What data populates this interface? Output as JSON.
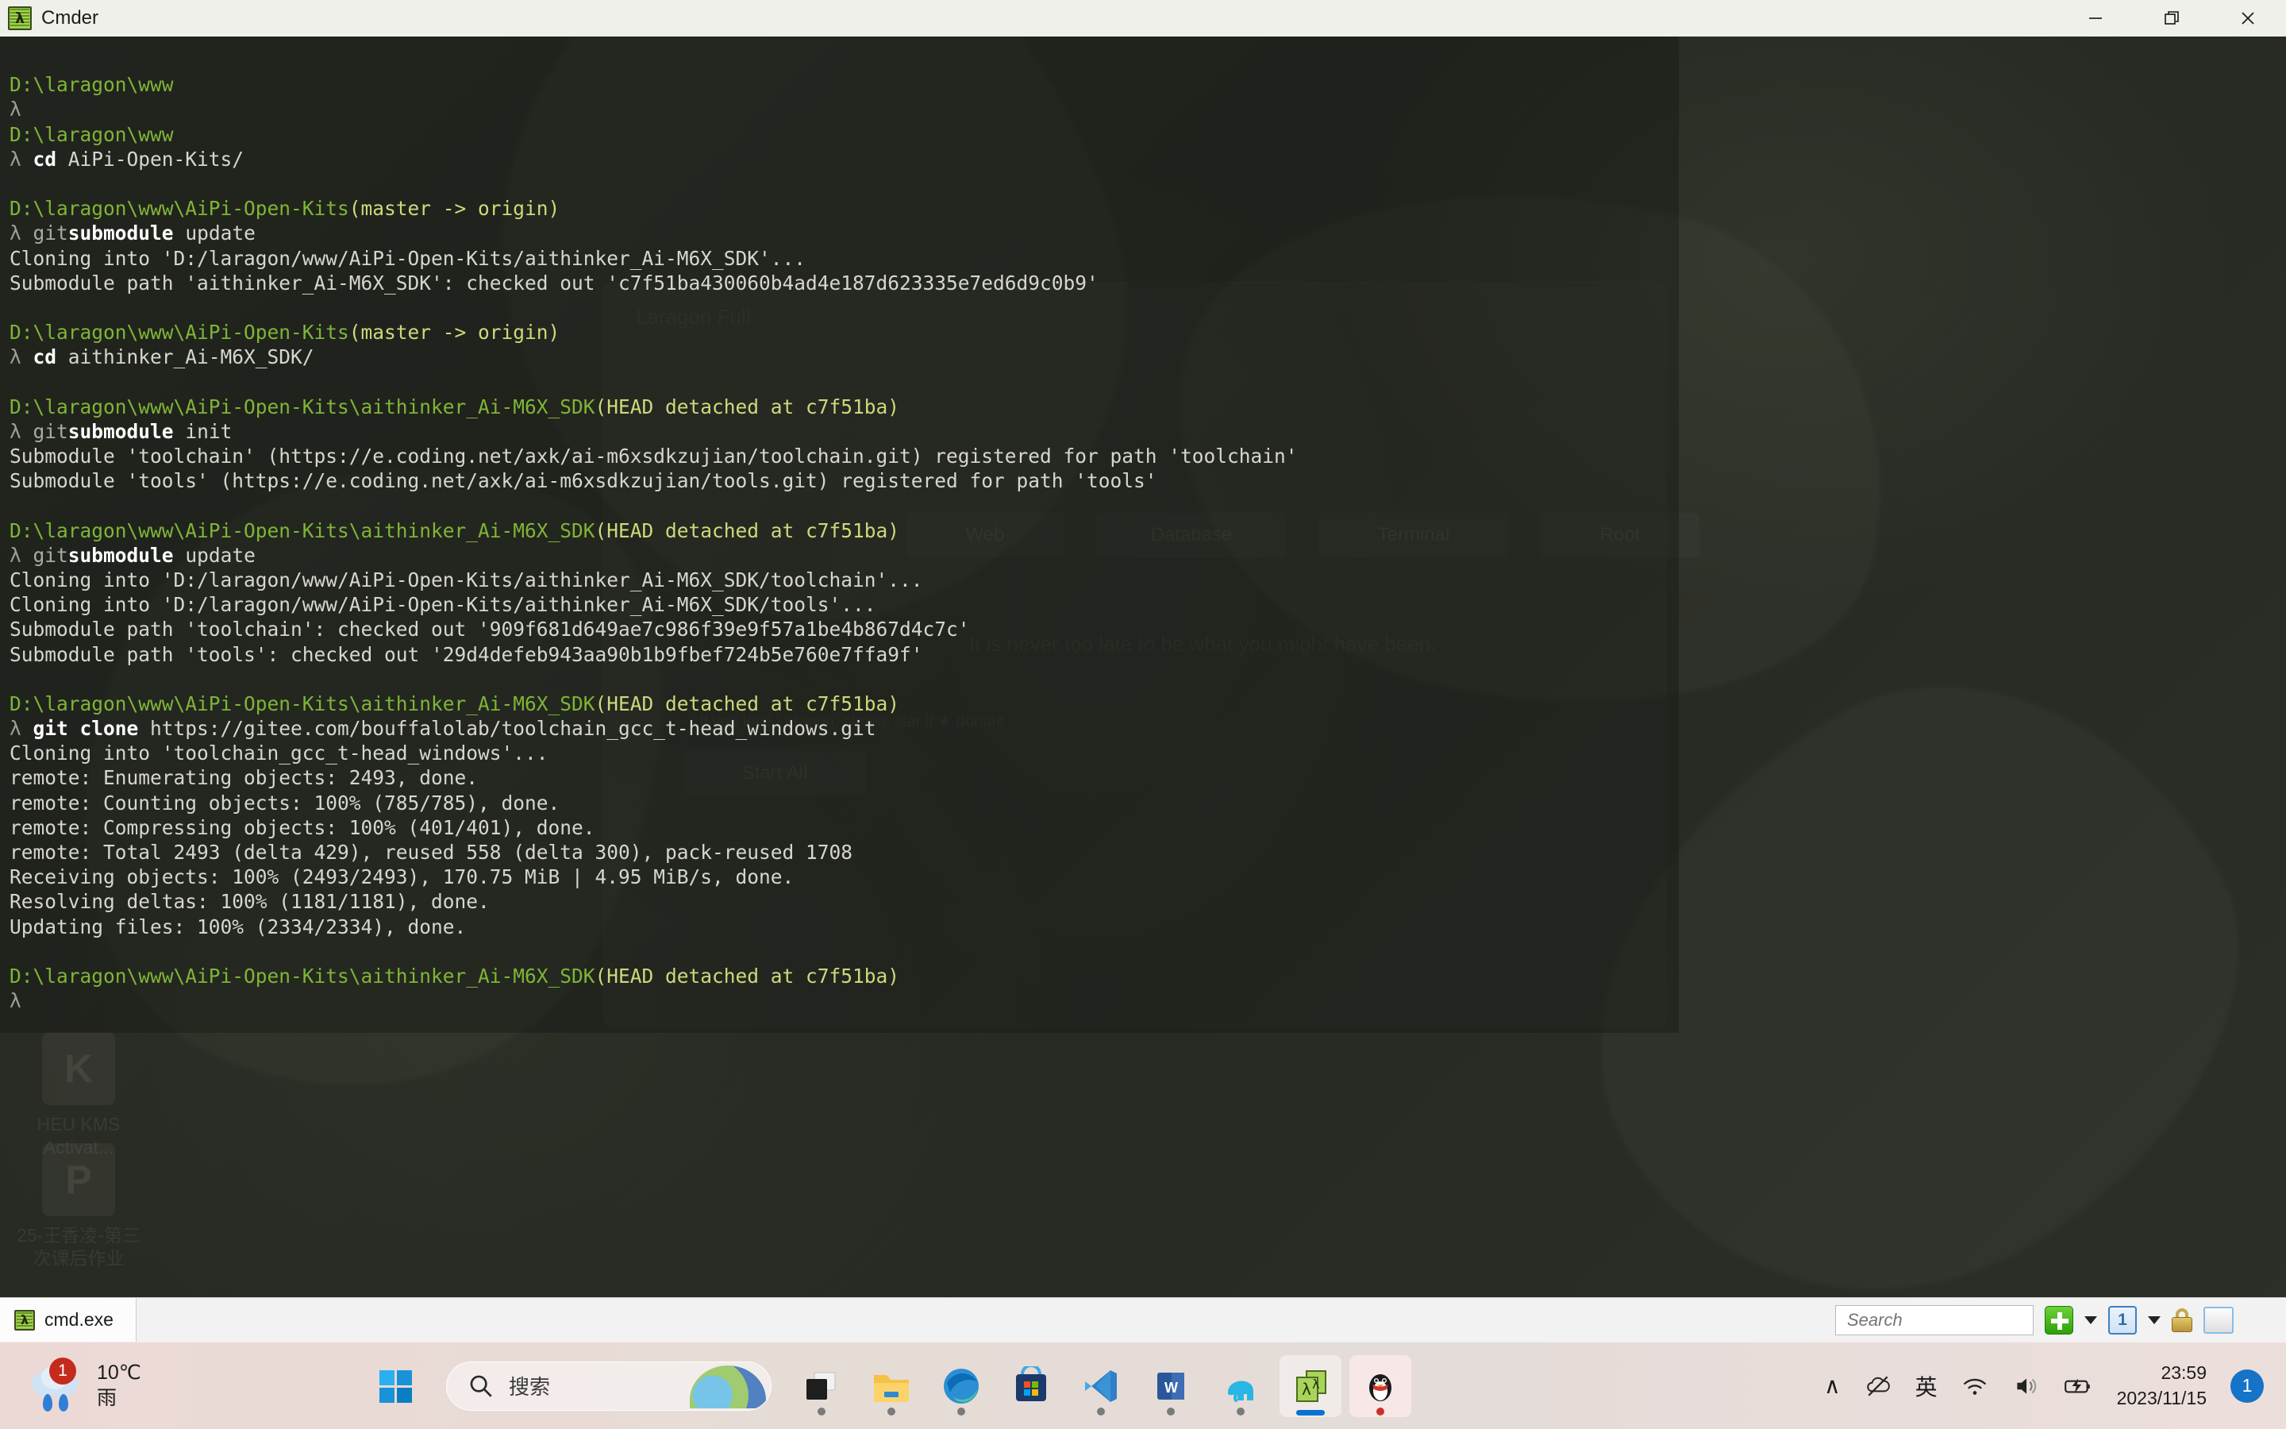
{
  "window": {
    "title": "Cmder",
    "icon": "cmder-lambda-icon",
    "controls": {
      "minimize": "—",
      "restore": "❐",
      "close": "✕"
    }
  },
  "terminal": {
    "lines": [
      {
        "type": "blank",
        "text": ""
      },
      {
        "type": "path",
        "text": "D:\\laragon\\www"
      },
      {
        "type": "prompt",
        "lambda": "λ",
        "cmd": "",
        "arg": ""
      },
      {
        "type": "path",
        "text": "D:\\laragon\\www"
      },
      {
        "type": "prompt",
        "lambda": "λ",
        "cmd": "cd",
        "arg": " AiPi-Open-Kits/"
      },
      {
        "type": "blank",
        "text": ""
      },
      {
        "type": "path-branch",
        "path": "D:\\laragon\\www\\AiPi-Open-Kits",
        "branch": "(master -> origin)"
      },
      {
        "type": "prompt-split",
        "lambda": "λ",
        "dim": "git",
        "cmd": "submodule",
        "arg": " update"
      },
      {
        "type": "out",
        "text": "Cloning into 'D:/laragon/www/AiPi-Open-Kits/aithinker_Ai-M6X_SDK'..."
      },
      {
        "type": "out",
        "text": "Submodule path 'aithinker_Ai-M6X_SDK': checked out 'c7f51ba430060b4ad4e187d623335e7ed6d9c0b9'"
      },
      {
        "type": "blank",
        "text": ""
      },
      {
        "type": "path-branch",
        "path": "D:\\laragon\\www\\AiPi-Open-Kits",
        "branch": "(master -> origin)"
      },
      {
        "type": "prompt",
        "lambda": "λ",
        "cmd": "cd",
        "arg": " aithinker_Ai-M6X_SDK/"
      },
      {
        "type": "blank",
        "text": ""
      },
      {
        "type": "path-branch",
        "path": "D:\\laragon\\www\\AiPi-Open-Kits\\aithinker_Ai-M6X_SDK",
        "branch": "(HEAD detached at c7f51ba)"
      },
      {
        "type": "prompt-split",
        "lambda": "λ",
        "dim": "git",
        "cmd": "submodule",
        "arg": " init"
      },
      {
        "type": "out",
        "text": "Submodule 'toolchain' (https://e.coding.net/axk/ai-m6xsdkzujian/toolchain.git) registered for path 'toolchain'"
      },
      {
        "type": "out",
        "text": "Submodule 'tools' (https://e.coding.net/axk/ai-m6xsdkzujian/tools.git) registered for path 'tools'"
      },
      {
        "type": "blank",
        "text": ""
      },
      {
        "type": "path-branch",
        "path": "D:\\laragon\\www\\AiPi-Open-Kits\\aithinker_Ai-M6X_SDK",
        "branch": "(HEAD detached at c7f51ba)"
      },
      {
        "type": "prompt-split",
        "lambda": "λ",
        "dim": "git",
        "cmd": "submodule",
        "arg": " update"
      },
      {
        "type": "out",
        "text": "Cloning into 'D:/laragon/www/AiPi-Open-Kits/aithinker_Ai-M6X_SDK/toolchain'..."
      },
      {
        "type": "out",
        "text": "Cloning into 'D:/laragon/www/AiPi-Open-Kits/aithinker_Ai-M6X_SDK/tools'..."
      },
      {
        "type": "out",
        "text": "Submodule path 'toolchain': checked out '909f681d649ae7c986f39e9f57a1be4b867d4c7c'"
      },
      {
        "type": "out",
        "text": "Submodule path 'tools': checked out '29d4defeb943aa90b1b9fbef724b5e760e7ffa9f'"
      },
      {
        "type": "blank",
        "text": ""
      },
      {
        "type": "path-branch",
        "path": "D:\\laragon\\www\\AiPi-Open-Kits\\aithinker_Ai-M6X_SDK",
        "branch": "(HEAD detached at c7f51ba)"
      },
      {
        "type": "prompt",
        "lambda": "λ",
        "cmd": "git clone",
        "arg": " https://gitee.com/bouffalolab/toolchain_gcc_t-head_windows.git"
      },
      {
        "type": "out",
        "text": "Cloning into 'toolchain_gcc_t-head_windows'..."
      },
      {
        "type": "out",
        "text": "remote: Enumerating objects: 2493, done."
      },
      {
        "type": "out",
        "text": "remote: Counting objects: 100% (785/785), done."
      },
      {
        "type": "out",
        "text": "remote: Compressing objects: 100% (401/401), done."
      },
      {
        "type": "out",
        "text": "remote: Total 2493 (delta 429), reused 558 (delta 300), pack-reused 1708"
      },
      {
        "type": "out",
        "text": "Receiving objects: 100% (2493/2493), 170.75 MiB | 4.95 MiB/s, done."
      },
      {
        "type": "out",
        "text": "Resolving deltas: 100% (1181/1181), done."
      },
      {
        "type": "out",
        "text": "Updating files: 100% (2334/2334), done."
      },
      {
        "type": "blank",
        "text": ""
      },
      {
        "type": "path-branch",
        "path": "D:\\laragon\\www\\AiPi-Open-Kits\\aithinker_Ai-M6X_SDK",
        "branch": "(HEAD detached at c7f51ba)"
      },
      {
        "type": "prompt",
        "lambda": "λ",
        "cmd": "",
        "arg": ""
      }
    ],
    "colors": {
      "path": "#7fb536",
      "branch": "#cdd97a",
      "output": "#d6d6d0",
      "command": "#ffffff",
      "background": "#2a2d26"
    }
  },
  "statusbar": {
    "tabs": [
      {
        "label": "cmd.exe",
        "icon": "cmder-lambda-icon"
      }
    ],
    "search": {
      "placeholder": "Search",
      "value": "",
      "icon": "search-icon"
    },
    "buttons": [
      {
        "name": "new-console-button",
        "icon": "green-plus-icon"
      },
      {
        "name": "new-console-dropdown",
        "icon": "caret-down-icon"
      },
      {
        "name": "active-console-count",
        "icon": "numbered-tab-icon",
        "label": "1"
      },
      {
        "name": "console-list-dropdown",
        "icon": "caret-down-icon"
      },
      {
        "name": "lock-button",
        "icon": "lock-icon"
      },
      {
        "name": "split-pane-button",
        "icon": "split-pane-icon"
      },
      {
        "name": "menu-button",
        "icon": "hamburger-menu-icon"
      }
    ]
  },
  "taskbar": {
    "weather": {
      "temperature": "10℃",
      "condition": "雨",
      "badge": "1",
      "icon": "rain-cloud-icon"
    },
    "start": {
      "name": "start-button",
      "icon": "windows-logo-icon"
    },
    "search": {
      "placeholder": "搜索",
      "icon": "search-icon"
    },
    "apps": [
      {
        "name": "task-view",
        "icon": "task-view-icon",
        "running": true,
        "active": false
      },
      {
        "name": "file-explorer",
        "icon": "folder-icon",
        "running": true,
        "active": false
      },
      {
        "name": "microsoft-edge",
        "icon": "edge-icon",
        "running": true,
        "active": false
      },
      {
        "name": "microsoft-store",
        "icon": "store-icon",
        "running": false,
        "active": false
      },
      {
        "name": "vs-code",
        "icon": "vscode-icon",
        "running": true,
        "active": false
      },
      {
        "name": "microsoft-word",
        "icon": "word-icon",
        "running": true,
        "active": false
      },
      {
        "name": "laragon",
        "icon": "elephant-icon",
        "running": true,
        "active": false
      },
      {
        "name": "cmder",
        "icon": "cmder-lambda-icon",
        "running": true,
        "active": true
      },
      {
        "name": "qq",
        "icon": "penguin-icon",
        "running": true,
        "active": false
      }
    ],
    "tray": [
      {
        "name": "show-hidden-icons",
        "glyph": "∧"
      },
      {
        "name": "onedrive-offline-icon",
        "glyph": "☁"
      },
      {
        "name": "ime-language-indicator",
        "glyph": "英"
      },
      {
        "name": "wifi-icon",
        "glyph": "◠"
      },
      {
        "name": "volume-icon",
        "glyph": "🔊"
      },
      {
        "name": "battery-icon",
        "glyph": "▭"
      }
    ],
    "clock": {
      "time": "23:59",
      "date": "2023/11/15"
    },
    "notifications": {
      "count": "1"
    }
  },
  "desktop": {
    "icons": [
      {
        "label": "HEU KMS Activat...",
        "glyph": "K"
      },
      {
        "label": "25-王香凌-第三次课后作业",
        "glyph": "P"
      }
    ],
    "laragon_window": {
      "title": "Laragon Full",
      "tagline": "It is never too late to be what you might have been.",
      "donate": "If you love Laragon, please star it ★ donate",
      "buttons": [
        {
          "label": "Start All",
          "icon": "play-icon"
        },
        {
          "label": "Web",
          "icon": "globe-icon"
        },
        {
          "label": "Database",
          "icon": "database-icon"
        },
        {
          "label": "Terminal",
          "icon": "terminal-icon"
        },
        {
          "label": "Root",
          "icon": "folder-icon"
        }
      ]
    }
  }
}
